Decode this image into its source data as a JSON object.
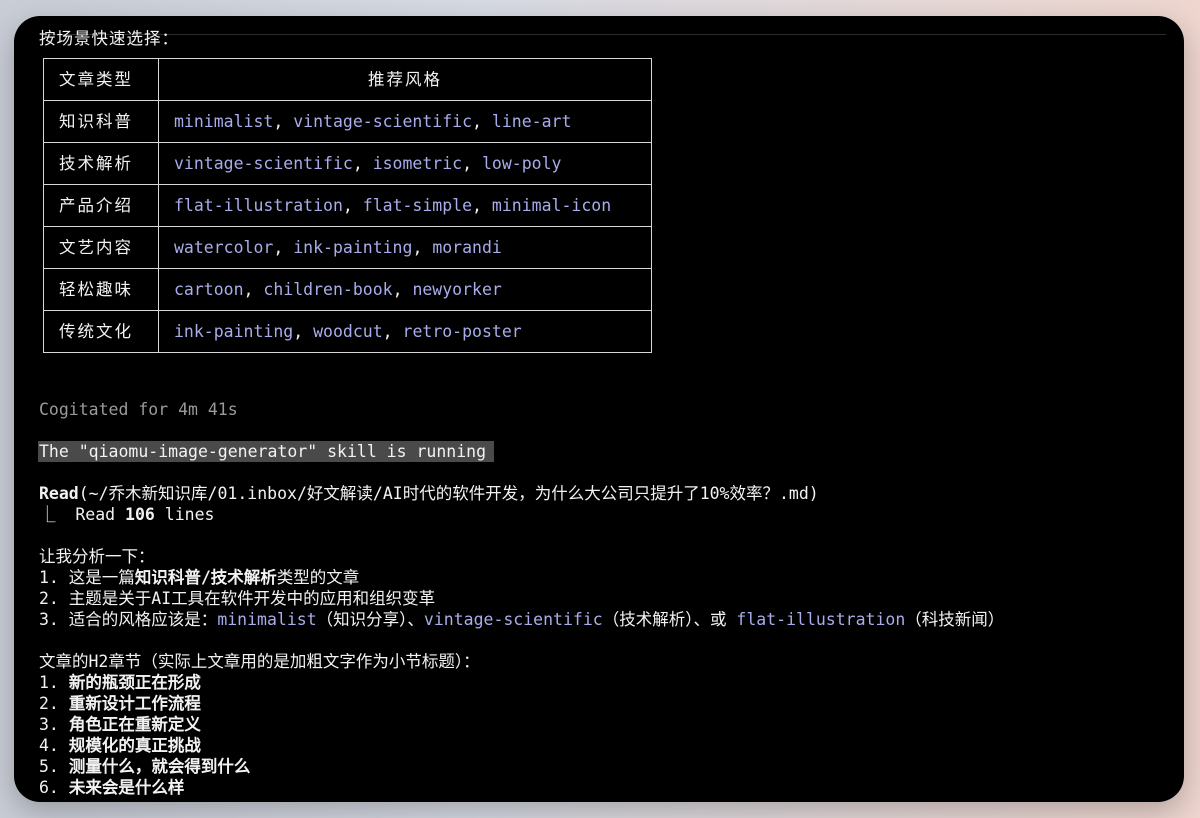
{
  "partial_heading": "按场景快速选择：",
  "table": {
    "headers": [
      "文章类型",
      "推荐风格"
    ],
    "rows": [
      {
        "type": "知识科普",
        "styles": [
          "minimalist",
          "vintage-scientific",
          "line-art"
        ]
      },
      {
        "type": "技术解析",
        "styles": [
          "vintage-scientific",
          "isometric",
          "low-poly"
        ]
      },
      {
        "type": "产品介绍",
        "styles": [
          "flat-illustration",
          "flat-simple",
          "minimal-icon"
        ]
      },
      {
        "type": "文艺内容",
        "styles": [
          "watercolor",
          "ink-painting",
          "morandi"
        ]
      },
      {
        "type": "轻松趣味",
        "styles": [
          "cartoon",
          "children-book",
          "newyorker"
        ]
      },
      {
        "type": "传统文化",
        "styles": [
          "ink-painting",
          "woodcut",
          "retro-poster"
        ]
      }
    ]
  },
  "cogitated": "Cogitated for 4m 41s",
  "skill_running": "The \"qiaomu-image-generator\" skill is running",
  "read": {
    "tool": "Read",
    "path": "(~/乔木新知识库/01.inbox/好文解读/AI时代的软件开发，为什么大公司只提升了10%效率？.md)",
    "result_prefix": "⎿  Read ",
    "result_count": "106",
    "result_suffix": " lines"
  },
  "analysis": {
    "intro": "让我分析一下：",
    "item1_prefix": "1. 这是一篇",
    "item1_bold": "知识科普/技术解析",
    "item1_suffix": "类型的文章",
    "item2": "2. 主题是关于AI工具在软件开发中的应用和组织变革",
    "item3_prefix": "3. 适合的风格应该是：",
    "item3_style1": "minimalist",
    "item3_note1": "（知识分享）、",
    "item3_style2": "vintage-scientific",
    "item3_note2": "（技术解析）、或 ",
    "item3_style3": "flat-illustration",
    "item3_note3": "（科技新闻）"
  },
  "sections": {
    "intro": "文章的H2章节（实际上文章用的是加粗文字作为小节标题）：",
    "items": [
      {
        "num": "1. ",
        "title": "新的瓶颈正在形成"
      },
      {
        "num": "2. ",
        "title": "重新设计工作流程"
      },
      {
        "num": "3. ",
        "title": "角色正在重新定义"
      },
      {
        "num": "4. ",
        "title": "规模化的真正挑战"
      },
      {
        "num": "5. ",
        "title": "测量什么，就会得到什么"
      },
      {
        "num": "6. ",
        "title": "未来会是什么样"
      }
    ]
  },
  "colors": {
    "background": "#000000",
    "text": "#f2f2f2",
    "accent": "#a8acea",
    "muted": "#9a9a9a",
    "banner_bg": "#4a4a4a"
  }
}
